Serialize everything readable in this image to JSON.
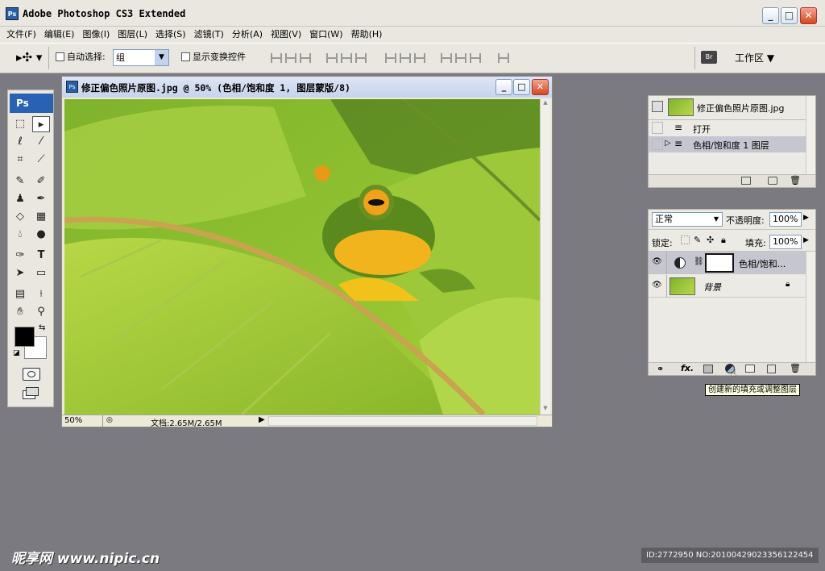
{
  "window": {
    "title": "Adobe Photoshop CS3 Extended",
    "app_icon": "Ps",
    "minimize": "_",
    "maximize": "□",
    "close": "✕"
  },
  "menu": [
    "文件(F)",
    "编辑(E)",
    "图像(I)",
    "图层(L)",
    "选择(S)",
    "滤镜(T)",
    "分析(A)",
    "视图(V)",
    "窗口(W)",
    "帮助(H)"
  ],
  "options": {
    "auto_select_label": "自动选择:",
    "auto_select_value": "组",
    "show_transform_label": "显示变换控件",
    "workspace_label": "工作区 ▼"
  },
  "toolbox": {
    "header": "Ps"
  },
  "document": {
    "icon": "Ps",
    "title": "修正偏色照片原图.jpg @ 50% (色相/饱和度 1, 图层蒙版/8)",
    "zoom": "50%",
    "doc_size": "文档:2.65M/2.65M"
  },
  "history": {
    "snapshot": "修正偏色照片原图.jpg",
    "steps": [
      "打开",
      "色相/饱和度 1 图层"
    ]
  },
  "layers": {
    "blend_mode": "正常",
    "opacity_label": "不透明度:",
    "opacity_value": "100%",
    "lock_label": "锁定:",
    "fill_label": "填充:",
    "fill_value": "100%",
    "items": [
      {
        "name": "色相/饱和...",
        "selected": true
      },
      {
        "name": "背景",
        "selected": false
      }
    ],
    "footer_fx": "fx."
  },
  "tooltip": "创建新的填充或调整图层",
  "watermark": "昵享网 www.nipic.cn",
  "id_tag": "ID:2772950 NO:20100429023356122454",
  "colors": {
    "accent": "#2961b4",
    "canvas_bg": "#7b7a80",
    "chrome": "#e9e7e0"
  }
}
